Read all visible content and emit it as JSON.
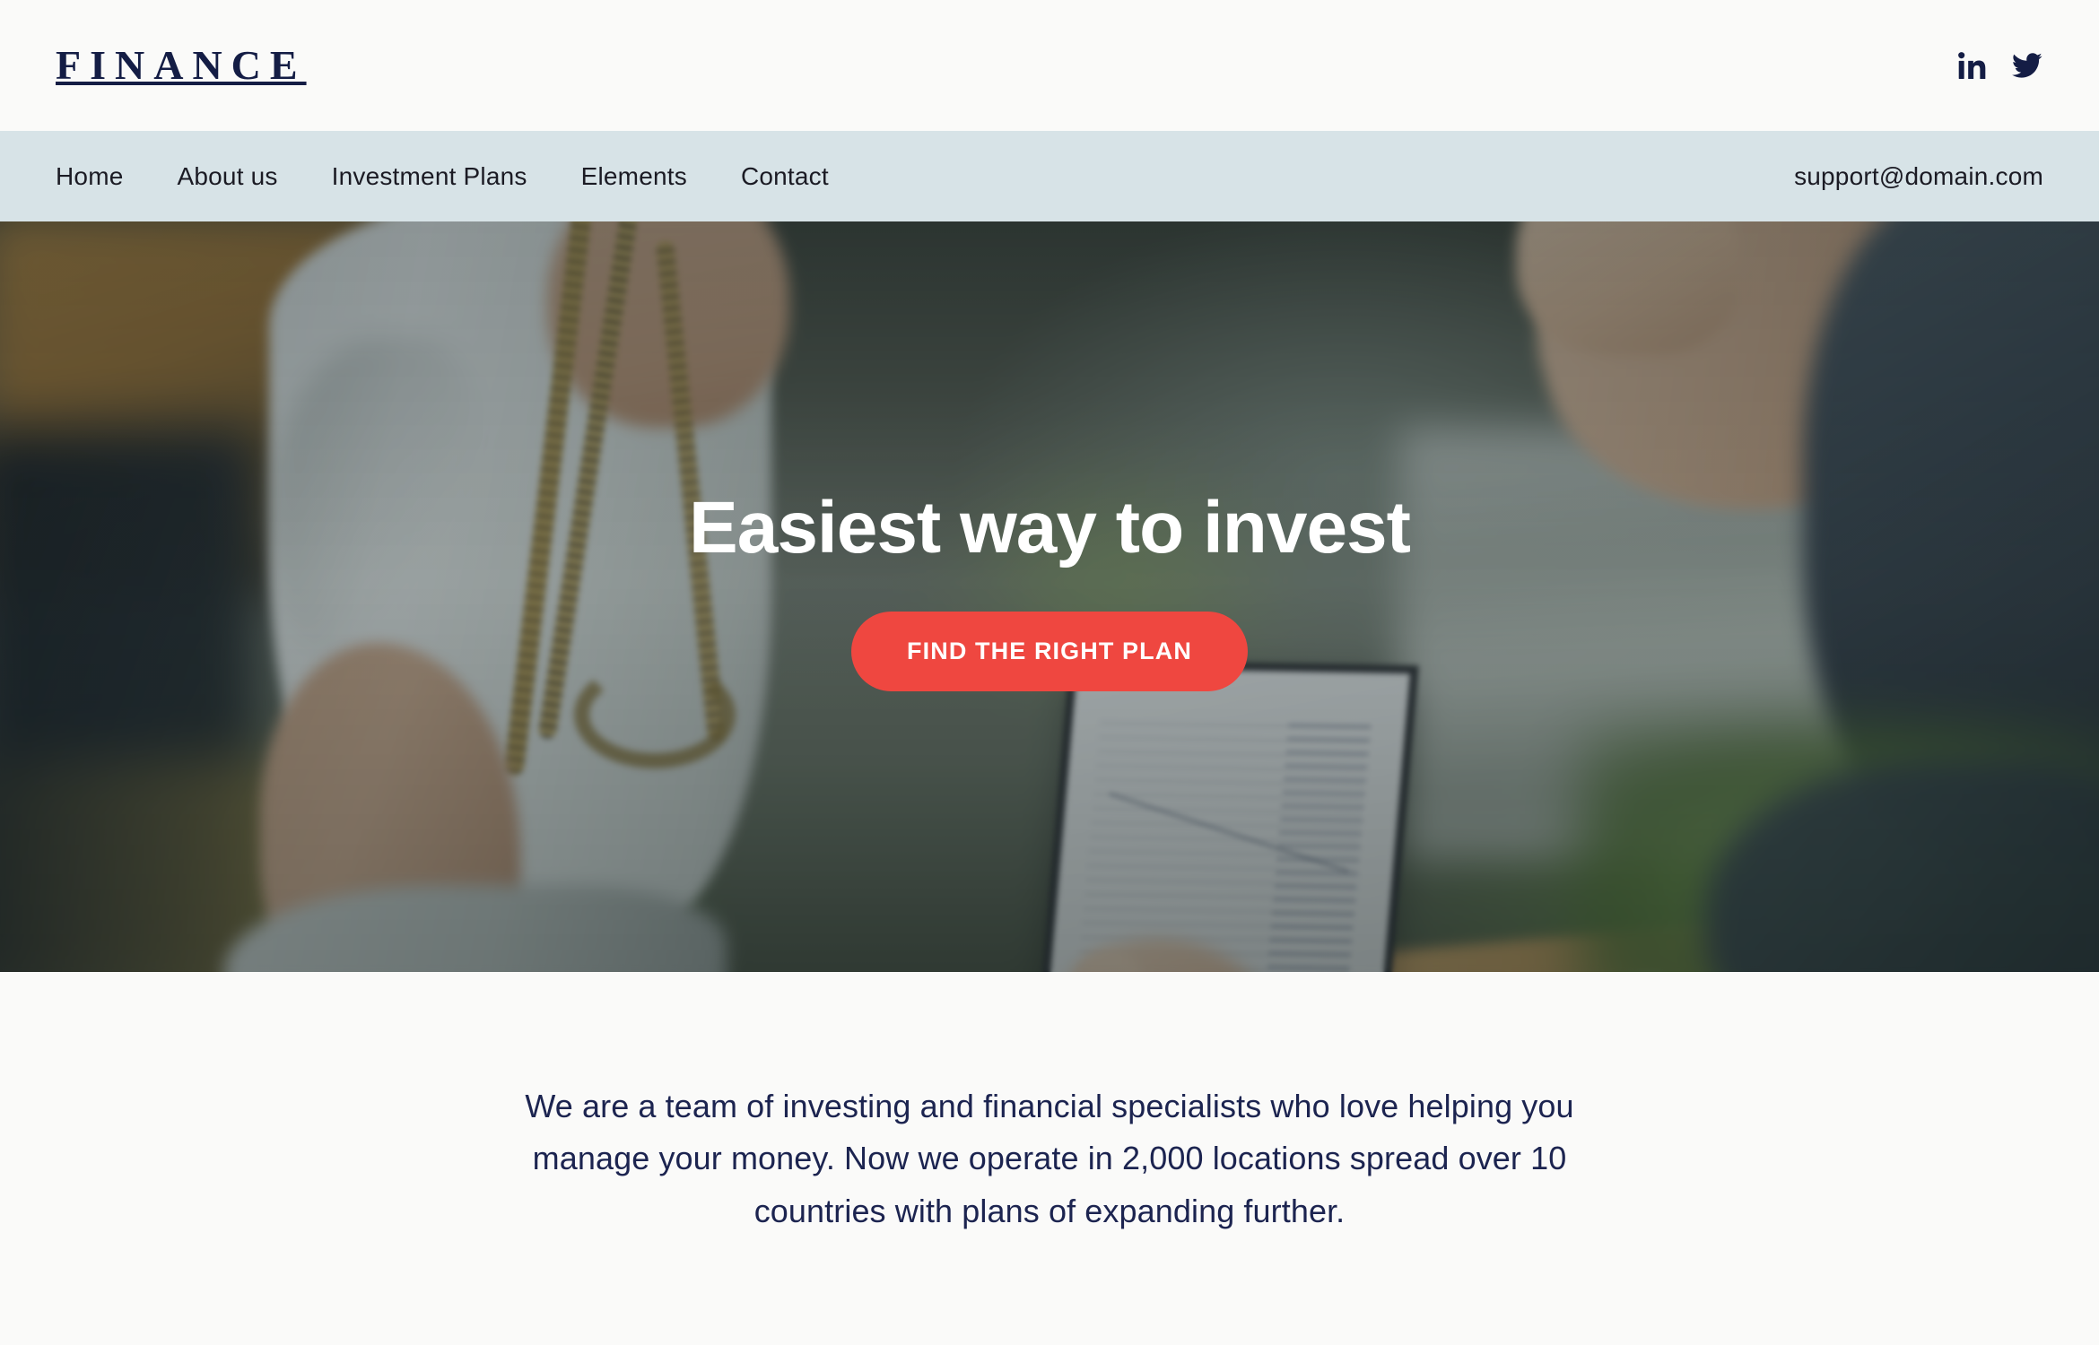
{
  "header": {
    "logo": "FINANCE",
    "social": [
      {
        "name": "linkedin-icon",
        "label": "LinkedIn"
      },
      {
        "name": "twitter-icon",
        "label": "Twitter"
      }
    ]
  },
  "nav": {
    "items": [
      {
        "label": "Home"
      },
      {
        "label": "About us"
      },
      {
        "label": "Investment Plans"
      },
      {
        "label": "Elements"
      },
      {
        "label": "Contact"
      }
    ],
    "email": "support@domain.com"
  },
  "hero": {
    "title": "Easiest way to invest",
    "cta_label": "FIND THE RIGHT PLAN",
    "image_description": "Woman in white blouse with beaded necklace seated outdoors beside a man gesturing over an open laptop with sunglasses and a phone on a wooden table"
  },
  "intro": {
    "paragraph": "We are a team of investing and financial specialists who love helping you manage your money. Now we operate in 2,000 locations spread over 10 countries with plans of expanding further."
  },
  "colors": {
    "brand_navy": "#141d45",
    "accent_red": "#ef4740",
    "nav_bg": "#d7e3e7",
    "page_bg": "#fafaf9",
    "hero_title": "#ffffff"
  }
}
